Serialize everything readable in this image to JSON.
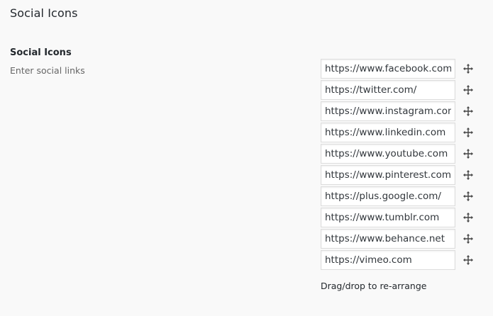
{
  "section": {
    "title": "Social Icons"
  },
  "field": {
    "title": "Social Icons",
    "description": "Enter social links"
  },
  "links": [
    {
      "value": "https://www.facebook.com/",
      "icon": "move-icon"
    },
    {
      "value": "https://twitter.com/",
      "icon": "move-icon"
    },
    {
      "value": "https://www.instagram.com/",
      "icon": "move-icon"
    },
    {
      "value": "https://www.linkedin.com",
      "icon": "move-icon"
    },
    {
      "value": "https://www.youtube.com",
      "icon": "move-icon"
    },
    {
      "value": "https://www.pinterest.com/",
      "icon": "move-icon"
    },
    {
      "value": "https://plus.google.com/",
      "icon": "move-icon"
    },
    {
      "value": "https://www.tumblr.com",
      "icon": "move-icon"
    },
    {
      "value": "https://www.behance.net",
      "icon": "move-icon"
    },
    {
      "value": "https://vimeo.com",
      "icon": "move-icon"
    }
  ],
  "hint": "Drag/drop to re-arrange",
  "colors": {
    "background": "#f9f9f9",
    "input_border": "#dddddd",
    "text": "#23282d",
    "description": "#666666"
  }
}
